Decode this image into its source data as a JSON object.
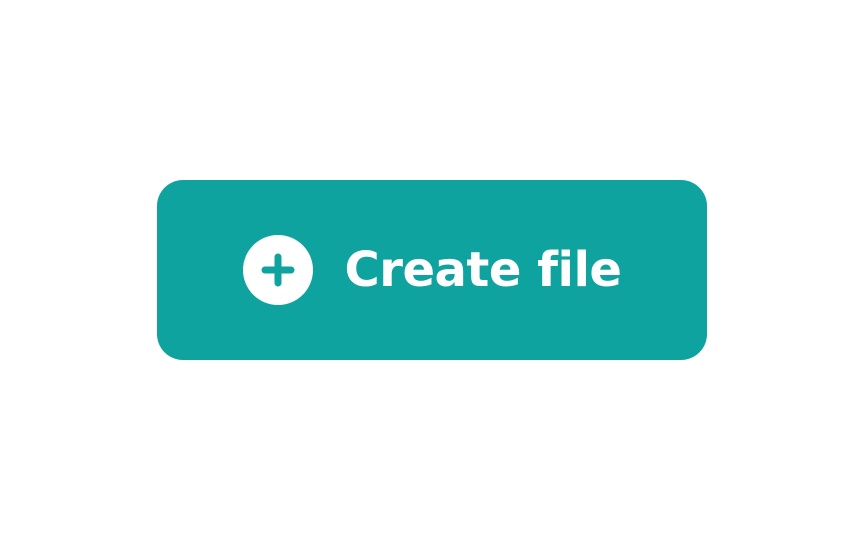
{
  "button": {
    "label": "Create file",
    "icon": "plus-circle-icon",
    "background_color": "#0ea39f",
    "text_color": "#ffffff",
    "icon_fill": "#ffffff",
    "icon_glyph_color": "#0ea39f"
  }
}
